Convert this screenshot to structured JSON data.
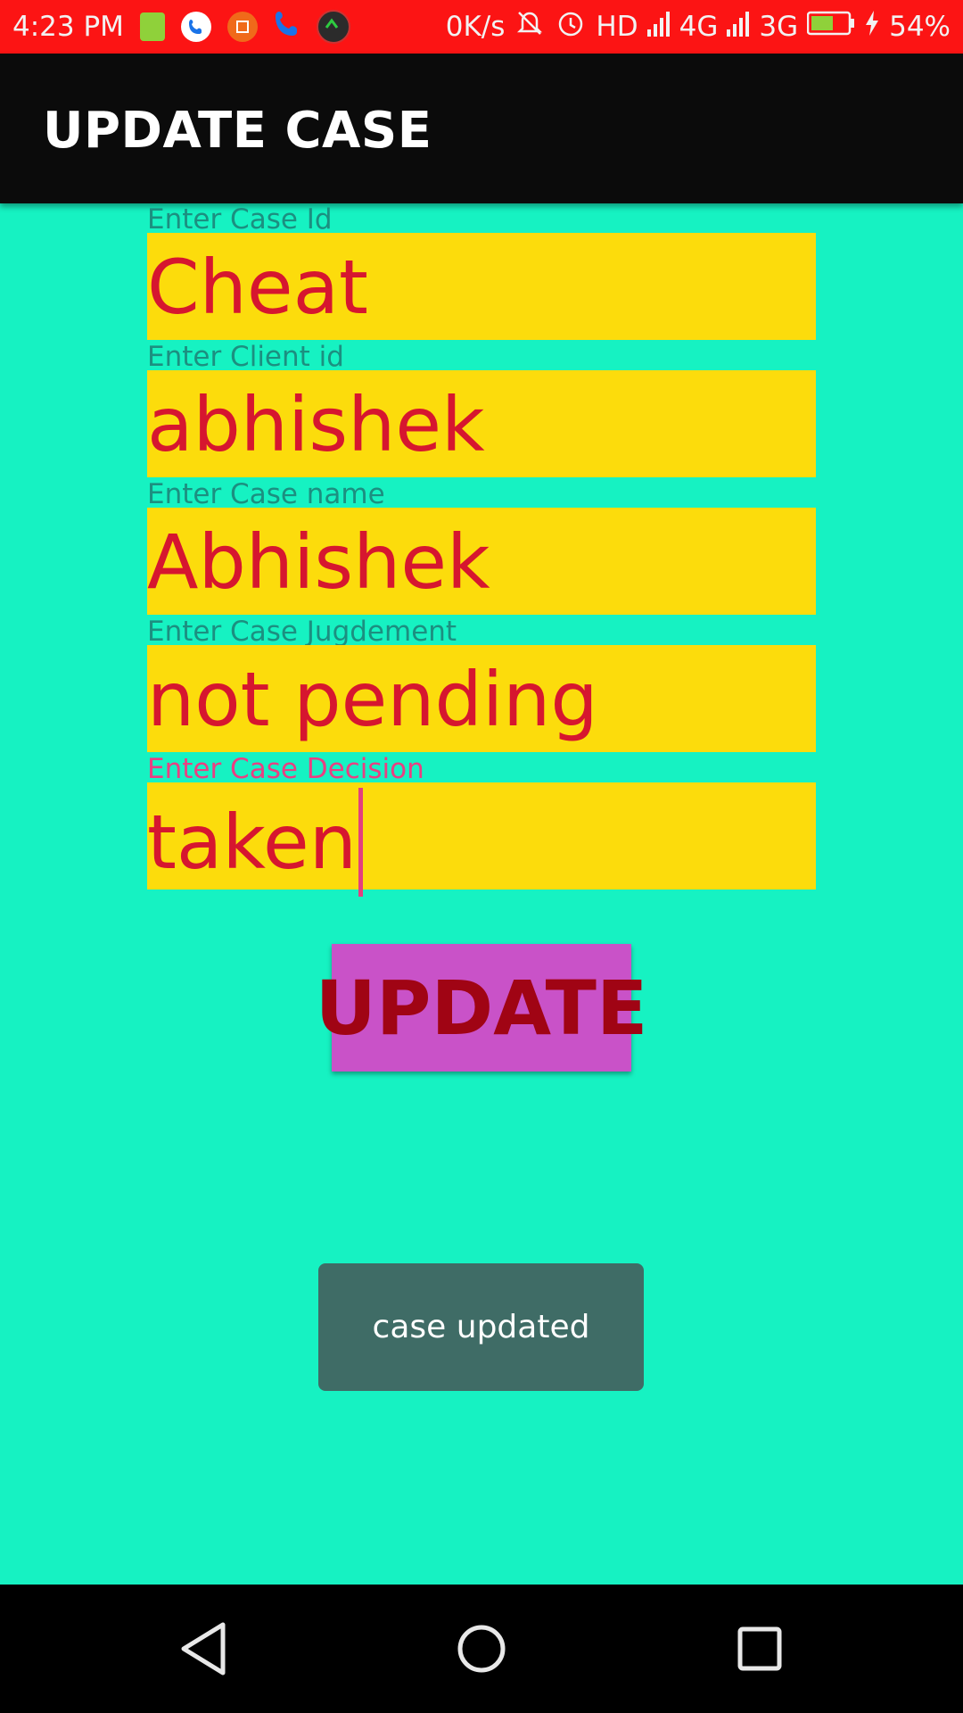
{
  "status_bar": {
    "time": "4:23 PM",
    "speed": "0K/s",
    "network_hd": "HD",
    "network_4g": "4G",
    "network_3g": "3G",
    "battery": "54%",
    "icons": [
      "notification-app-icon",
      "phone-icon",
      "screenshot-icon",
      "call-icon",
      "recorder-icon",
      "mute-icon",
      "alarm-icon",
      "signal-icon",
      "battery-icon",
      "charging-icon"
    ]
  },
  "app_bar": {
    "title": "UPDATE CASE"
  },
  "form": {
    "fields": [
      {
        "label": "Enter Case Id",
        "value": "Cheat"
      },
      {
        "label": "Enter Client id",
        "value": "abhishek"
      },
      {
        "label": "Enter Case name",
        "value": "Abhishek"
      },
      {
        "label": "Enter Case Jugdement",
        "value": "not pending"
      },
      {
        "label": "Enter Case Decision",
        "value": "taken"
      }
    ],
    "update_label": "UPDATE"
  },
  "toast": {
    "message": "case updated"
  },
  "colors": {
    "status_bar": "#fc1414",
    "background": "#16f2c2",
    "app_bar": "#0b0b0b",
    "field_bg": "#fcdc0c",
    "field_text": "#d6162f",
    "button_bg": "#c952c8",
    "button_text": "#a00414",
    "toast_bg": "#3f6c66"
  },
  "nav_bar": {
    "icons": [
      "back-icon",
      "home-icon",
      "recents-icon"
    ]
  }
}
